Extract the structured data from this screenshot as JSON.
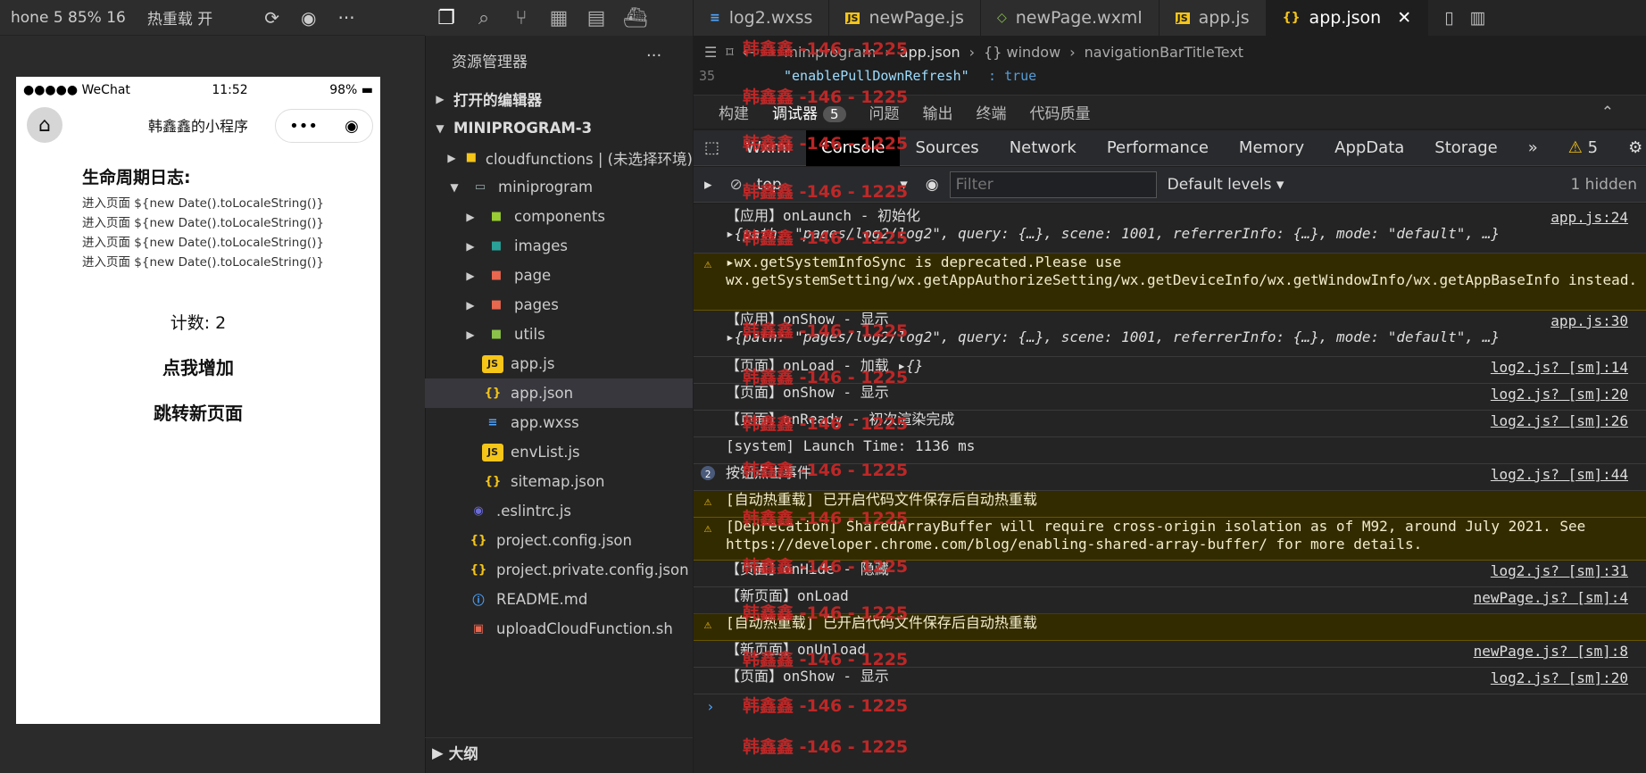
{
  "simulator": {
    "toolbar": {
      "device": "hone 5 85% 16",
      "hot_reload": "热重载 开"
    },
    "status": {
      "carrier": "●●●●● WeChat",
      "time": "11:52",
      "battery": "98%"
    },
    "nav_title": "韩鑫鑫的小程序",
    "capsule": {
      "more": "•••",
      "close": "◉"
    },
    "log_title": "生命周期日志:",
    "log_lines": [
      "进入页面 ${new Date().toLocaleString()}",
      "进入页面 ${new Date().toLocaleString()}",
      "进入页面 ${new Date().toLocaleString()}",
      "进入页面 ${new Date().toLocaleString()}"
    ],
    "counter": "计数: 2",
    "increment_button": "点我增加",
    "navigate_button": "跳转新页面"
  },
  "explorer": {
    "title": "资源管理器",
    "open_editors": "打开的编辑器",
    "project": "MINIPROGRAM-3",
    "tree": [
      {
        "label": "cloudfunctions | (未选择环境)",
        "icon": "folder"
      },
      {
        "label": "miniprogram",
        "icon": "folder-open"
      },
      {
        "label": "components",
        "icon": "folder-components"
      },
      {
        "label": "images",
        "icon": "folder-images"
      },
      {
        "label": "page",
        "icon": "folder-page"
      },
      {
        "label": "pages",
        "icon": "folder-pages"
      },
      {
        "label": "utils",
        "icon": "folder-utils"
      },
      {
        "label": "app.js",
        "icon": "js"
      },
      {
        "label": "app.json",
        "icon": "json"
      },
      {
        "label": "app.wxss",
        "icon": "css"
      },
      {
        "label": "envList.js",
        "icon": "js"
      },
      {
        "label": "sitemap.json",
        "icon": "json"
      },
      {
        "label": ".eslintrc.js",
        "icon": "eslint"
      },
      {
        "label": "project.config.json",
        "icon": "json"
      },
      {
        "label": "project.private.config.json",
        "icon": "json"
      },
      {
        "label": "README.md",
        "icon": "info"
      },
      {
        "label": "uploadCloudFunction.sh",
        "icon": "shell"
      }
    ],
    "outline": "大纲"
  },
  "editor": {
    "tabs": [
      {
        "label": "log2.wxss",
        "icon": "css"
      },
      {
        "label": "newPage.js",
        "icon": "js"
      },
      {
        "label": "newPage.wxml",
        "icon": "wxml"
      },
      {
        "label": "app.js",
        "icon": "js"
      },
      {
        "label": "app.json",
        "icon": "json"
      }
    ],
    "breadcrumb": [
      "miniprogram",
      "app.json",
      "{} window",
      "navigationBarTitleText"
    ],
    "line_number": "35",
    "code_key": "\"enablePullDownRefresh\"",
    "code_value": "true"
  },
  "panel": {
    "tabs": [
      "构建",
      "调试器",
      "问题",
      "输出",
      "终端",
      "代码质量"
    ],
    "debugger_badge": "5"
  },
  "devtools": {
    "tabs": [
      "Wxml",
      "Console",
      "Sources",
      "Network",
      "Performance",
      "Memory",
      "AppData",
      "Storage"
    ],
    "warning_count": "5",
    "context": "top",
    "filter_placeholder": "Filter",
    "levels": "Default levels",
    "hidden": "1 hidden"
  },
  "console": {
    "lines": [
      {
        "text": "【应用】onLaunch - 初始化",
        "src": "app.js:24"
      },
      {
        "text": "【应用】onShow - 显示",
        "src": "app.js:30"
      },
      {
        "text": "【页面】onLoad - 加载",
        "src": "log2.js? [sm]:14"
      },
      {
        "text": "【页面】onShow - 显示",
        "src": "log2.js? [sm]:20"
      },
      {
        "text": "【页面】onReady - 初次渲染完成",
        "src": "log2.js? [sm]:26"
      },
      {
        "text": "[system] Launch Time: 1136 ms",
        "src": ""
      },
      {
        "text": "按钮点击事件",
        "src": "log2.js? [sm]:44"
      },
      {
        "text": "【页面】onHide - 隐藏",
        "src": "log2.js? [sm]:31"
      },
      {
        "text": "【新页面】onLoad",
        "src": "newPage.js? [sm]:4"
      },
      {
        "text": "【新页面】onUnload",
        "src": "newPage.js? [sm]:8"
      },
      {
        "text": "【页面】onShow - 显示",
        "src": "log2.js? [sm]:20"
      }
    ],
    "obj1": "{path: \"pages/log2/log2\", query: {…}, scene: 1001, referrerInfo: {…}, mode: \"default\", …}",
    "warn1": "wx.getSystemInfoSync is deprecated.Please use wx.getSystemSetting/wx.getAppAuthorizeSetting/wx.getDeviceInfo/wx.getWindowInfo/wx.getAppBaseInfo instead.",
    "warn_hot1": "[自动热重载] 已开启代码文件保存后自动热重载",
    "warn_dep": "[Deprecation] SharedArrayBuffer will require cross-origin isolation as of M92, around July 2021. See https://developer.chrome.com/blog/enabling-shared-array-buffer/ for more details.",
    "warn_hot2": "[自动热重载] 已开启代码文件保存后自动热重载",
    "repeat_count": "2",
    "empty_obj": "{}",
    "prompt": "›"
  },
  "watermark": "韩鑫鑫 -146 - 1225"
}
